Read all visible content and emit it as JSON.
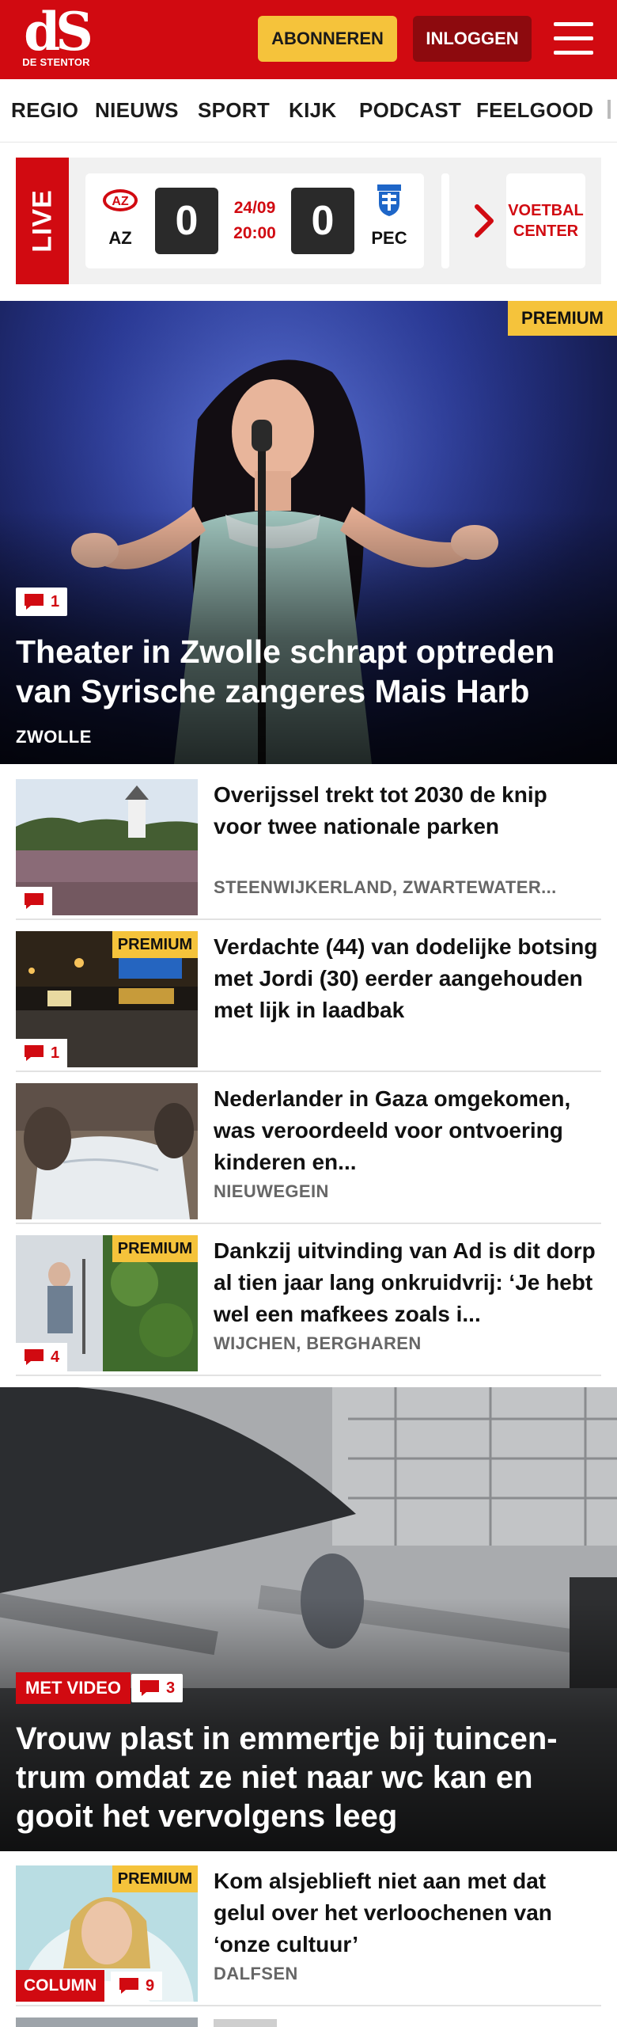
{
  "header": {
    "logo_mark": "dS",
    "logo_text": "DE STENTOR",
    "subscribe_label": "ABONNEREN",
    "login_label": "INLOGGEN",
    "menu_icon": "hamburger-icon",
    "brand_color": "#d10a11",
    "accent_color": "#f5c33b"
  },
  "nav": {
    "items": [
      "REGIO",
      "NIEUWS",
      "SPORT",
      "KIJK",
      "PODCAST",
      "FEELGOOD"
    ]
  },
  "live": {
    "label": "LIVE",
    "match": {
      "home_team": "AZ",
      "away_team": "PEC",
      "home_score": "0",
      "away_score": "0",
      "date": "24/09",
      "time": "20:00"
    },
    "voetbal_center_line1": "VOETBAL",
    "voetbal_center_line2": "CENTER"
  },
  "hero1": {
    "premium": "PREMIUM",
    "comments": "1",
    "title": "Theater in Zwolle schrapt optreden van Syrische zangeres Mais Harb",
    "tag": "ZWOLLE"
  },
  "articles": [
    {
      "title": "Overijssel trekt tot 2030 de knip voor twee nationale parken",
      "tag": "STEENWIJKERLAND, ZWARTEWATER...",
      "comments": "",
      "premium": ""
    },
    {
      "title": "Verdachte (44) van dodelijke botsing met Jordi (30) eerder aangehouden met lijk in laadbak",
      "tag": "",
      "comments": "1",
      "premium": "PREMIUM"
    },
    {
      "title": "Nederlander in Gaza omgekomen, was veroordeeld voor ontvoering kinderen en...",
      "tag": "NIEUWEGEIN",
      "comments": "",
      "premium": ""
    },
    {
      "title": "Dankzij uitvinding van Ad is dit dorp al tien jaar lang onkruidvrij: ‘Je hebt wel een mafkees zoals i...",
      "tag": "WIJCHEN, BERGHAREN",
      "comments": "4",
      "premium": "PREMIUM"
    }
  ],
  "hero2": {
    "video_label": "MET VIDEO",
    "comments": "3",
    "title": "Vrouw plast in emmertje bij tuincen-trum omdat ze niet naar wc kan en gooit het vervolgens leeg"
  },
  "column_item": {
    "premium": "PREMIUM",
    "column_label": "COLUMN",
    "comments": "9",
    "title": "Kom alsjeblieft niet aan met dat gelul over het verloochenen van ‘onze cultuur’",
    "tag": "DALFSEN"
  }
}
